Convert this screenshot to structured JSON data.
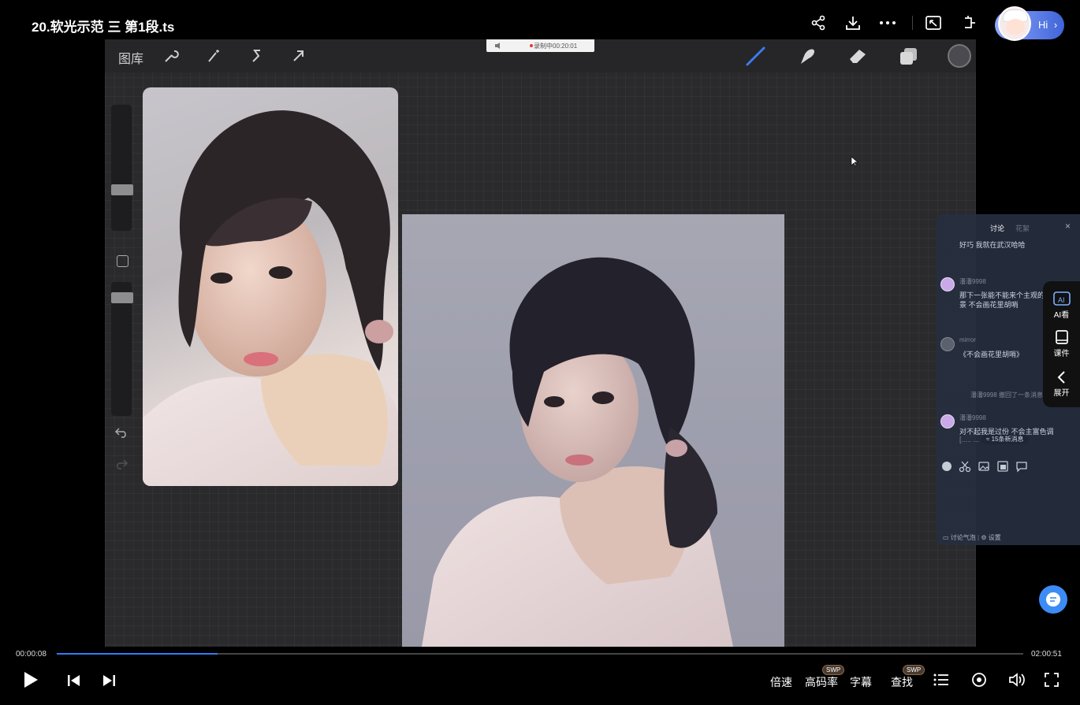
{
  "window": {
    "title": "20.软光示范 三 第1段.ts"
  },
  "topbar": {
    "icons": [
      "share-icon",
      "download-icon",
      "more-icon",
      "picture-in-picture-icon",
      "pin-window-icon"
    ],
    "assistant_button_label": "Hi",
    "assistant_chevron": "›"
  },
  "video": {
    "app_toolbar": {
      "gallery_label": "图库",
      "left_tools": [
        "wrench-icon",
        "magic-wand-icon",
        "selection-icon",
        "transform-arrow-icon"
      ],
      "right_tools": [
        "brush-icon",
        "smudge-icon",
        "eraser-icon",
        "layers-icon",
        "color-swatch-icon"
      ]
    },
    "recording_badge": "录制中00:20:01",
    "rail_icons": [
      "undo-icon",
      "redo-icon"
    ]
  },
  "chat": {
    "tabs": [
      "讨论",
      "花絮"
    ],
    "close_label": "×",
    "messages": [
      {
        "name": "",
        "text": "好巧 我就在武汉哈哈"
      },
      {
        "name": "潘潘9998",
        "text": "那下一张能不能来个主观的色",
        "text2": "景 不会画花里胡哨"
      },
      {
        "name": "mirror",
        "text": "《不会画花里胡哨》"
      },
      {
        "name": "",
        "system": "潘潘9998 撤回了一条消息"
      },
      {
        "name": "潘潘9998",
        "text": "对不起我是过份 不会主富色调",
        "text2": "[.....  ..."
      }
    ],
    "new_messages_label": "≈ 15条新消息",
    "tools": [
      "emoji-icon",
      "scissors-icon",
      "image-icon",
      "screenshot-icon",
      "quick-reply-icon"
    ],
    "footer_bubble_label": "讨论气泡",
    "footer_settings_label": "设置"
  },
  "dock": {
    "items": [
      {
        "label": "AI看",
        "icon": "ai-view-icon"
      },
      {
        "label": "课件",
        "icon": "courseware-icon"
      },
      {
        "label": "展开",
        "icon": "expand-icon"
      }
    ]
  },
  "player": {
    "current_time": "00:00:08",
    "total_time": "02:00:51",
    "progress": 0.166,
    "speed_label": "倍速",
    "bitrate_label": "高码率",
    "subtitle_label": "字幕",
    "search_label": "查找",
    "swp_badge": "SWP"
  },
  "colors": {
    "accent": "#2f7cf6",
    "panel_bg": "#262f40",
    "canvas_bg": "#2a2a2d"
  }
}
